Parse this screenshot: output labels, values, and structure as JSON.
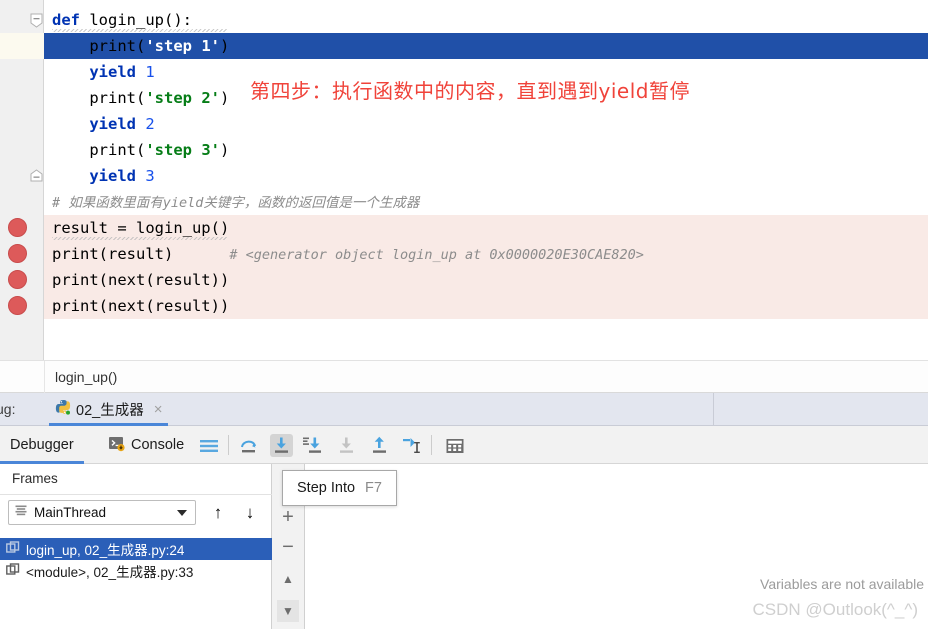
{
  "editor": {
    "lines": [
      {
        "indent": 0,
        "tokens": [
          {
            "t": "kw",
            "v": "def"
          },
          {
            "t": "sp",
            "v": " "
          },
          {
            "t": "fn",
            "v": "login_up():"
          }
        ],
        "bp": false,
        "current": false,
        "fold": "start"
      },
      {
        "indent": 1,
        "tokens": [
          {
            "t": "fn",
            "v": "print("
          },
          {
            "t": "str",
            "v": "'step 1'"
          },
          {
            "t": "fn",
            "v": ")"
          }
        ],
        "bp": false,
        "current": true,
        "fold": ""
      },
      {
        "indent": 1,
        "tokens": [
          {
            "t": "kw",
            "v": "yield"
          },
          {
            "t": "sp",
            "v": " "
          },
          {
            "t": "num",
            "v": "1"
          }
        ],
        "bp": false,
        "current": false,
        "fold": ""
      },
      {
        "indent": 1,
        "tokens": [
          {
            "t": "fn",
            "v": "print("
          },
          {
            "t": "str",
            "v": "'step 2'"
          },
          {
            "t": "fn",
            "v": ")"
          }
        ],
        "bp": false,
        "current": false,
        "fold": ""
      },
      {
        "indent": 1,
        "tokens": [
          {
            "t": "kw",
            "v": "yield"
          },
          {
            "t": "sp",
            "v": " "
          },
          {
            "t": "num",
            "v": "2"
          }
        ],
        "bp": false,
        "current": false,
        "fold": ""
      },
      {
        "indent": 1,
        "tokens": [
          {
            "t": "fn",
            "v": "print("
          },
          {
            "t": "str",
            "v": "'step 3'"
          },
          {
            "t": "fn",
            "v": ")"
          }
        ],
        "bp": false,
        "current": false,
        "fold": ""
      },
      {
        "indent": 1,
        "tokens": [
          {
            "t": "kw",
            "v": "yield"
          },
          {
            "t": "sp",
            "v": " "
          },
          {
            "t": "num",
            "v": "3"
          }
        ],
        "bp": false,
        "current": false,
        "fold": "end"
      },
      {
        "indent": 0,
        "tokens": [
          {
            "t": "cmt",
            "v": "# 如果函数里面有yield关键字，函数的返回值是一个生成器"
          }
        ],
        "bp": false,
        "current": false,
        "fold": ""
      },
      {
        "indent": 0,
        "tokens": [
          {
            "t": "fn",
            "v": "result = login_up()"
          }
        ],
        "bp": true,
        "current": false,
        "fold": ""
      },
      {
        "indent": 0,
        "tokens": [
          {
            "t": "fn",
            "v": "print(result)"
          },
          {
            "t": "sp",
            "v": "      "
          },
          {
            "t": "cmt",
            "v": "# <generator object login_up at 0x0000020E30CAE820>"
          }
        ],
        "bp": true,
        "current": false,
        "fold": ""
      },
      {
        "indent": 0,
        "tokens": [
          {
            "t": "fn",
            "v": "print(next(result))"
          }
        ],
        "bp": true,
        "current": false,
        "fold": ""
      },
      {
        "indent": 0,
        "tokens": [
          {
            "t": "fn",
            "v": "print(next(result))"
          }
        ],
        "bp": true,
        "current": false,
        "fold": ""
      }
    ],
    "annotation": "第四步：执行函数中的内容，直到遇到yield暂停",
    "annotation_color": "#f0433a",
    "current_line_bg": "#2050a8",
    "breakpoint_bg": "#f9eae6",
    "breakpoint_color": "#dd5a5a"
  },
  "breadcrumb": {
    "path": "login_up()"
  },
  "debug_window": {
    "label": "ug:",
    "tab": {
      "name": "02_生成器",
      "icon": "python-icon",
      "close": "×"
    }
  },
  "toolbar": {
    "tabs": [
      {
        "label": "Debugger",
        "active": true,
        "icon": ""
      },
      {
        "label": "Console",
        "active": false,
        "icon": "console-icon"
      }
    ],
    "buttons": [
      {
        "name": "mute-breakpoints-icon",
        "title": ""
      },
      {
        "name": "step-over-icon",
        "title": "Step Over",
        "state": "normal"
      },
      {
        "name": "step-into-icon",
        "title": "Step Into",
        "state": "selected"
      },
      {
        "name": "force-step-into-icon",
        "title": "Force Step Into",
        "state": "normal"
      },
      {
        "name": "step-into-my-code-icon",
        "title": "Step Into My Code",
        "state": "disabled"
      },
      {
        "name": "step-out-icon",
        "title": "Step Out",
        "state": "normal"
      },
      {
        "name": "run-to-cursor-icon",
        "title": "Run to Cursor",
        "state": "normal"
      },
      {
        "name": "evaluate-expression-icon",
        "title": "Evaluate Expression",
        "state": "normal"
      }
    ]
  },
  "tooltip": {
    "label": "Step Into",
    "shortcut": "F7"
  },
  "frames": {
    "title": "Frames",
    "thread": {
      "icon": "thread-icon",
      "value": "MainThread"
    },
    "nav_up": "↑",
    "nav_down": "↓",
    "rows": [
      {
        "label": "login_up, 02_生成器.py:24",
        "selected": true
      },
      {
        "label": "<module>, 02_生成器.py:33",
        "selected": false
      }
    ]
  },
  "side_controls": {
    "add": "+",
    "remove": "−",
    "up": "▲",
    "down": "▼"
  },
  "variables": {
    "message": "Variables are not available",
    "watermark": "CSDN @Outlook(^_^)"
  }
}
